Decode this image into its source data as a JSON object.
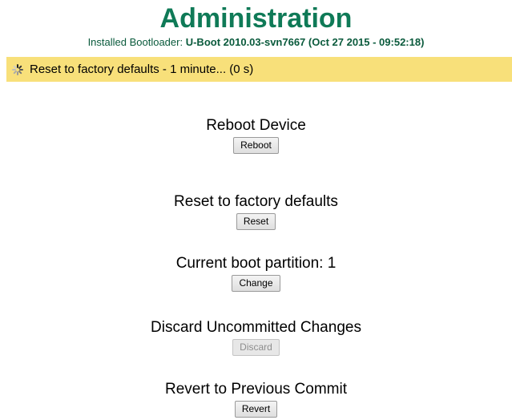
{
  "header": {
    "title": "Administration",
    "bootloader_label": "Installed Bootloader:",
    "bootloader_value": "U-Boot 2010.03-svn7667 (Oct 27 2015 - 09:52:18)"
  },
  "status": {
    "message": "Reset to factory defaults - 1 minute...  (0 s)",
    "icon": "spinner-icon"
  },
  "sections": {
    "reboot": {
      "heading": "Reboot Device",
      "button": "Reboot"
    },
    "reset": {
      "heading": "Reset to factory defaults",
      "button": "Reset"
    },
    "partition": {
      "heading": "Current boot partition: 1",
      "button": "Change"
    },
    "discard": {
      "heading": "Discard Uncommitted Changes",
      "button": "Discard",
      "disabled": true
    },
    "revert": {
      "heading": "Revert to Previous Commit",
      "button": "Revert"
    }
  },
  "colors": {
    "title": "#0f7a57",
    "status_background": "#f8e07a"
  }
}
